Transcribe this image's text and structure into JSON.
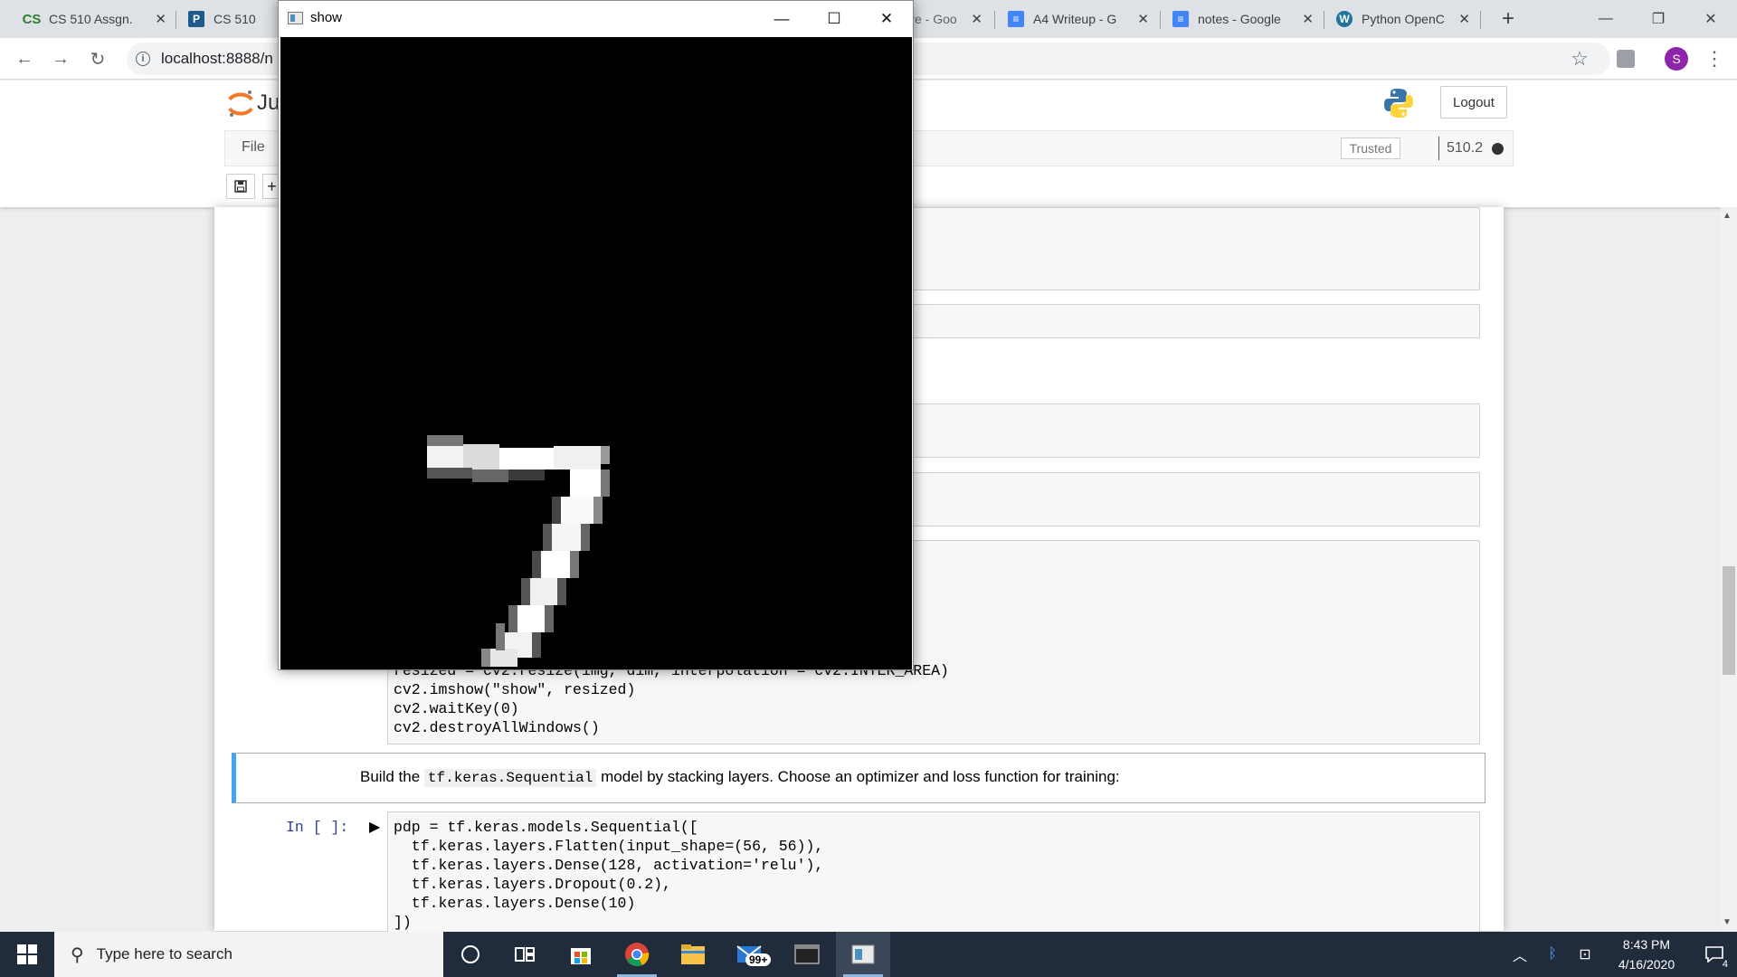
{
  "browser": {
    "tabs": [
      {
        "title": "CS 510 Assgn.",
        "favicon": "CS",
        "favicon_color": "#2e7d32"
      },
      {
        "title": "CS 510",
        "favicon": "P",
        "favicon_color": "#1e5b8c"
      },
      {
        "title": "ve - Goo",
        "favicon": "",
        "favicon_color": "#dee1e6"
      },
      {
        "title": "A4 Writeup - G",
        "favicon": "≡",
        "favicon_color": "#4285f4"
      },
      {
        "title": "notes - Google",
        "favicon": "≡",
        "favicon_color": "#4285f4"
      },
      {
        "title": "Python OpenC",
        "favicon": "W",
        "favicon_color": "#21759b"
      }
    ],
    "new_tab": "+",
    "url": "localhost:8888/n",
    "profile_initial": "S"
  },
  "jupyter": {
    "logo_partial": "Ju",
    "logout_label": "Logout",
    "menu_file": "File",
    "trusted_label": "Trusted",
    "kernel_name": "510.2"
  },
  "notebook": {
    "cell1_code": [
      "resized = cv2.resize(img, dim, interpolation = cv2.INTER_AREA)",
      "cv2.imshow(\"show\", resized)",
      "cv2.waitKey(0)",
      "cv2.destroyAllWindows()"
    ],
    "markdown": {
      "before": "Build the",
      "code": "tf.keras.Sequential",
      "after": "model by stacking layers. Choose an optimizer and loss function for training:"
    },
    "prompt": "In [ ]:",
    "cell2_code": [
      "pdp = tf.keras.models.Sequential([",
      "  tf.keras.layers.Flatten(input_shape=(56, 56)),",
      "  tf.keras.layers.Dense(128, activation='relu'),",
      "  tf.keras.layers.Dropout(0.2),",
      "  tf.keras.layers.Dense(10)",
      "])"
    ]
  },
  "cv_window": {
    "title": "show"
  },
  "taskbar": {
    "search_placeholder": "Type here to search",
    "mail_badge": "99+",
    "time": "8:43 PM",
    "date": "4/16/2020",
    "notification_count": "4"
  }
}
